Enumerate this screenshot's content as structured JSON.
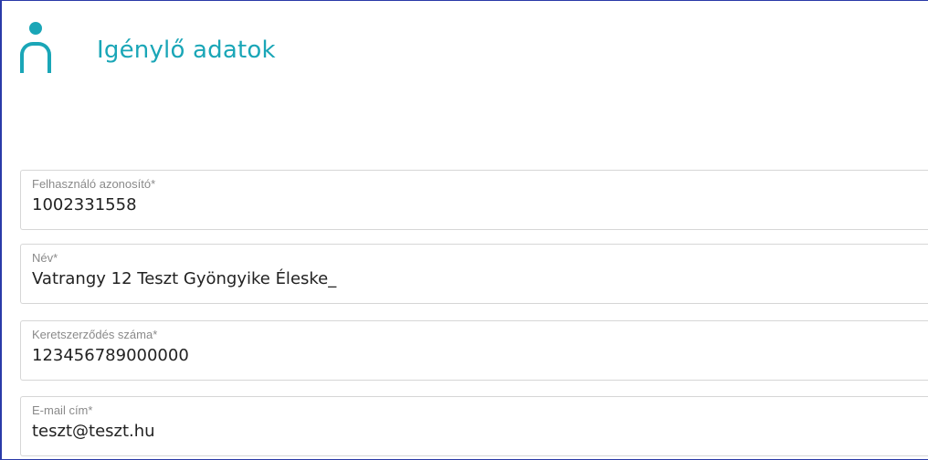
{
  "header": {
    "title": "Igénylő adatok",
    "icon": "person-icon",
    "accent_color": "#1aa6b7"
  },
  "form": {
    "fields": [
      {
        "label": "Felhasználó azonosító*",
        "value": "1002331558"
      },
      {
        "label": "Név*",
        "value": "Vatrangy 12 Teszt Gyöngyike Éleske_"
      },
      {
        "label": "Keretszerződés száma*",
        "value": "123456789000000"
      },
      {
        "label": "E-mail cím*",
        "value": "teszt@teszt.hu"
      }
    ]
  }
}
